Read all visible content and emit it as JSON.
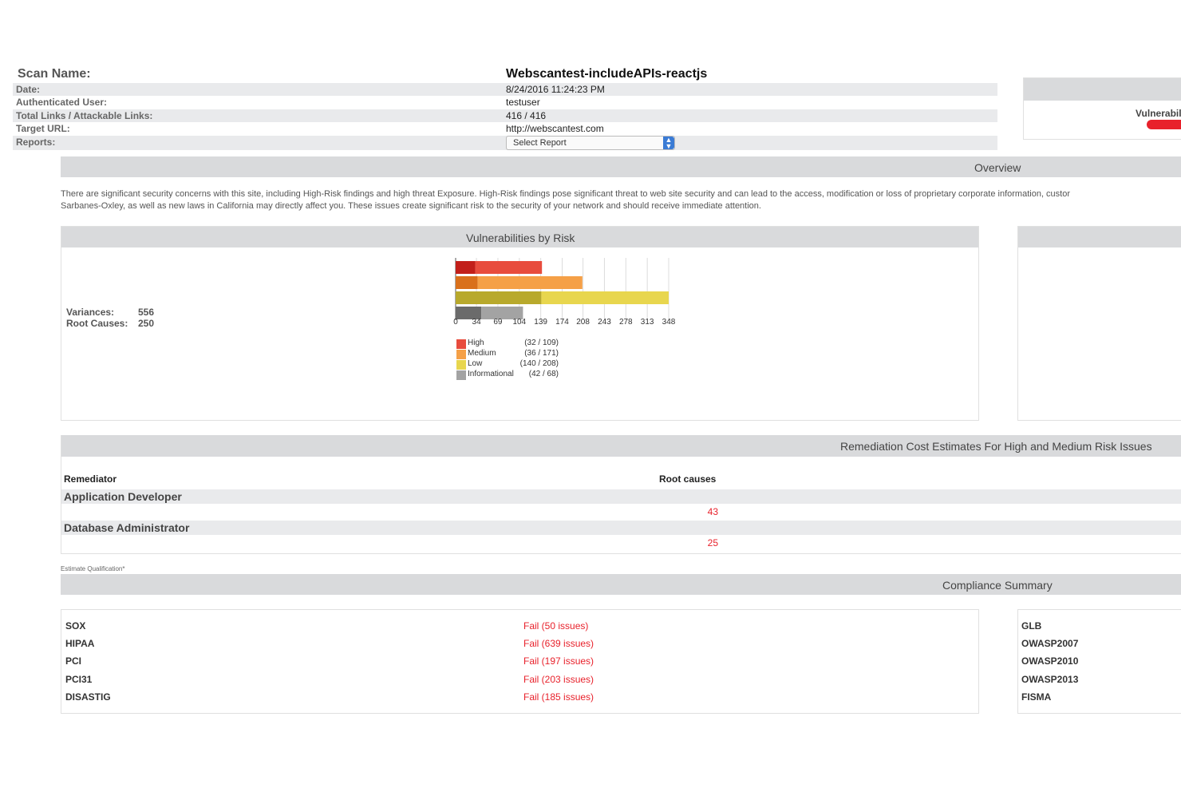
{
  "scan": {
    "name_label": "Scan Name:",
    "name_value": "Webscantest-includeAPIs-reactjs",
    "fields": [
      {
        "label": "Date:",
        "value": "8/24/2016 11:24:23 PM"
      },
      {
        "label": "Authenticated User:",
        "value": "testuser"
      },
      {
        "label": "Total Links / Attackable Links:",
        "value": "416 / 416"
      },
      {
        "label": "Target URL:",
        "value": "http://webscantest.com"
      },
      {
        "label": "Reports:",
        "value": ""
      }
    ],
    "report_select": "Select Report"
  },
  "side_widget": {
    "label": "Vulnerabil"
  },
  "overview": {
    "title": "Overview",
    "line1": "There are significant security concerns with this site, including High-Risk findings and high threat Exposure. High-Risk findings pose significant threat to web site security and can lead to the access, modification or loss of proprietary corporate information, custor",
    "line2": "Sarbanes-Oxley, as well as new laws in California may directly affect you. These issues create significant risk to the security of your network and should receive immediate attention."
  },
  "vuln_panel": {
    "title": "Vulnerabilities by Risk",
    "variances_label": "Variances:",
    "variances_value": "556",
    "root_causes_label": "Root Causes:",
    "root_causes_value": "250"
  },
  "chart_data": {
    "type": "bar",
    "orientation": "horizontal",
    "stacked": true,
    "categories": [
      "High",
      "Medium",
      "Low",
      "Informational"
    ],
    "series": [
      {
        "name": "root causes",
        "values": [
          32,
          36,
          140,
          42
        ]
      },
      {
        "name": "variances",
        "values": [
          109,
          171,
          208,
          68
        ]
      }
    ],
    "legend": [
      {
        "name": "High",
        "count": "(32 / 109)"
      },
      {
        "name": "Medium",
        "count": "(36 / 171)"
      },
      {
        "name": "Low",
        "count": "(140 / 208)"
      },
      {
        "name": "Informational",
        "count": "(42 / 68)"
      }
    ],
    "colors": {
      "High": [
        "#c21f1a",
        "#e84c3d"
      ],
      "Medium": [
        "#d9701c",
        "#f5a047"
      ],
      "Low": [
        "#b8a92c",
        "#e8d64e"
      ],
      "Informational": [
        "#6b6b6b",
        "#a3a3a3"
      ]
    },
    "xticks": [
      "0",
      "34",
      "69",
      "104",
      "139",
      "174",
      "208",
      "243",
      "278",
      "313",
      "348"
    ],
    "xlim": [
      0,
      348
    ],
    "grid": true
  },
  "remediation": {
    "title": "Remediation Cost Estimates For High and Medium Risk Issues",
    "col_remediator": "Remediator",
    "col_root_causes": "Root causes",
    "rows": [
      {
        "role": "Application Developer",
        "value": "43"
      },
      {
        "role": "Database Administrator",
        "value": "25"
      }
    ],
    "footnote": "Estimate Qualification*"
  },
  "compliance": {
    "title": "Compliance Summary",
    "left": [
      {
        "name": "SOX",
        "result": "Fail (50 issues)"
      },
      {
        "name": "HIPAA",
        "result": "Fail (639 issues)"
      },
      {
        "name": "PCI",
        "result": "Fail (197 issues)"
      },
      {
        "name": "PCI31",
        "result": "Fail (203 issues)"
      },
      {
        "name": "DISASTIG",
        "result": "Fail (185 issues)"
      }
    ],
    "right": [
      {
        "name": "GLB"
      },
      {
        "name": "OWASP2007"
      },
      {
        "name": "OWASP2010"
      },
      {
        "name": "OWASP2013"
      },
      {
        "name": "FISMA"
      }
    ]
  }
}
